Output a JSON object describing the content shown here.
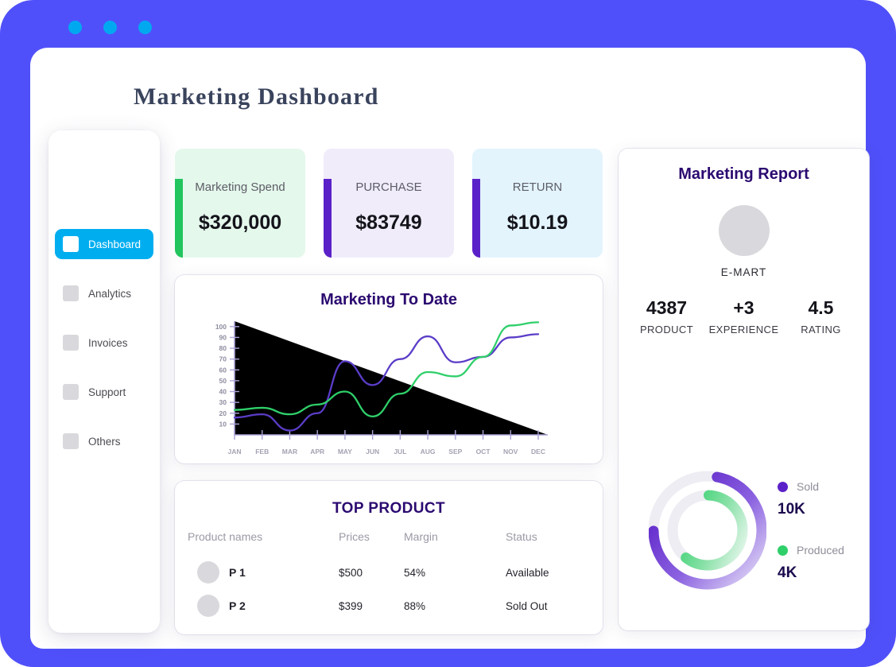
{
  "window": {
    "frame_color": "#5050fa",
    "dots": [
      "window-dot-1",
      "window-dot-2",
      "window-dot-3"
    ],
    "dot_color": "#00a8f0"
  },
  "header": {
    "title": "Marketing  Dashboard"
  },
  "sidebar": {
    "items": [
      {
        "label": "Dashboard",
        "icon": "square-icon",
        "active": true
      },
      {
        "label": "Analytics",
        "icon": "square-icon",
        "active": false
      },
      {
        "label": "Invoices",
        "icon": "square-icon",
        "active": false
      },
      {
        "label": "Support",
        "icon": "square-icon",
        "active": false
      },
      {
        "label": "Others",
        "icon": "square-icon",
        "active": false
      }
    ],
    "active_color": "#00aef0"
  },
  "stats": [
    {
      "label": "Marketing Spend",
      "value": "$320,000",
      "bar_color": "#22c55e",
      "bg_color": "#e4f8ec"
    },
    {
      "label": "PURCHASE",
      "value": "$83749",
      "bar_color": "#5b21c8",
      "bg_color": "#f0ecfa"
    },
    {
      "label": "RETURN",
      "value": "$10.19",
      "bar_color": "#5b21c8",
      "bg_color": "#e3f4fd"
    }
  ],
  "chart_data": {
    "type": "line",
    "title": "Marketing To Date",
    "xlabel": "",
    "ylabel": "",
    "grid": false,
    "legend_position": "none",
    "x": [
      "JAN",
      "FEB",
      "MAR",
      "APR",
      "MAY",
      "JUN",
      "JUL",
      "AUG",
      "SEP",
      "OCT",
      "NOV",
      "DEC"
    ],
    "categories": [
      "JAN",
      "FEB",
      "MAR",
      "APR",
      "MAY",
      "JUN",
      "JUL",
      "AUG",
      "SEP",
      "OCT",
      "NOV",
      "DEC"
    ],
    "yticks": [
      10,
      20,
      30,
      40,
      50,
      60,
      70,
      80,
      90,
      100
    ],
    "ylim": [
      0,
      105
    ],
    "series": [
      {
        "name": "Purple series",
        "color": "#5b3dc8",
        "values": [
          16,
          19,
          4,
          20,
          68,
          46,
          70,
          91,
          67,
          72,
          90,
          93
        ]
      },
      {
        "name": "Green series",
        "color": "#2fcf6a",
        "values": [
          23,
          25,
          19,
          28,
          40,
          17,
          38,
          58,
          54,
          72,
          101,
          104
        ]
      }
    ]
  },
  "top_product": {
    "title": "TOP PRODUCT",
    "columns": [
      "Product names",
      "Prices",
      "Margin",
      "Status"
    ],
    "rows": [
      {
        "name": "P 1",
        "price": "$500",
        "margin": "54%",
        "status": "Available"
      },
      {
        "name": "P 2",
        "price": "$399",
        "margin": "88%",
        "status": "Sold Out"
      }
    ]
  },
  "report": {
    "title": "Marketing Report",
    "brand": "E-MART",
    "stats": [
      {
        "value": "4387",
        "label": "PRODUCT"
      },
      {
        "value": "+3",
        "label": "EXPERIENCE"
      },
      {
        "value": "4.5",
        "label": "RATING"
      }
    ],
    "donut": {
      "type": "doughnut",
      "outer": {
        "name": "Sold",
        "value": "10K",
        "percent": 72,
        "color": "#5b21c8"
      },
      "inner": {
        "name": "Produced",
        "value": "4K",
        "percent": 60,
        "color": "#2fcf6a"
      },
      "track_color": "#ededf3"
    },
    "legend": [
      {
        "label": "Sold",
        "value": "10K",
        "color": "#5b21c8"
      },
      {
        "label": "Produced",
        "value": "4K",
        "color": "#2fcf6a"
      }
    ]
  }
}
